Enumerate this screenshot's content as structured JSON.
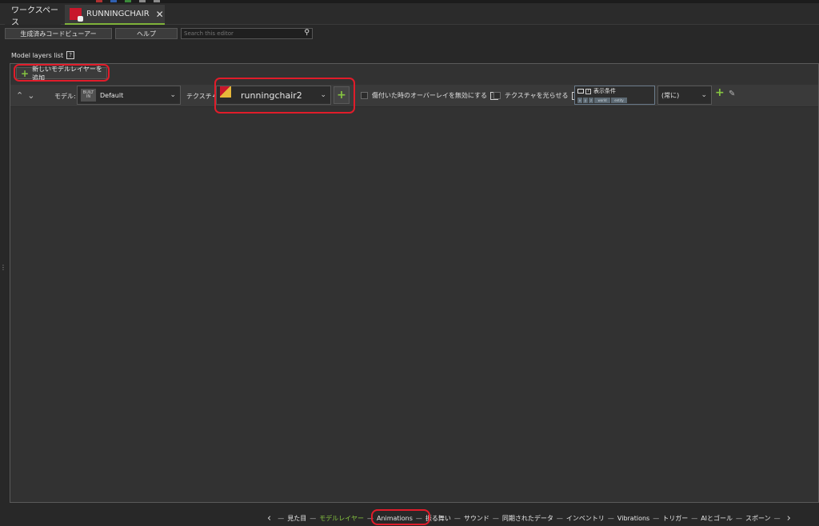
{
  "tabs": {
    "workspace_label": "ワークスペース",
    "mod_label": "RUNNINGCHAIR",
    "close_glyph": "✕"
  },
  "toolbar": {
    "code_viewer_label": "生成済みコードビューアー",
    "help_label": "ヘルプ",
    "search_placeholder": "Search this editor"
  },
  "section": {
    "title": "Model layers list",
    "help_glyph": "?"
  },
  "add_layer": {
    "label": "新しいモデルレイヤーを追加"
  },
  "layer_row": {
    "model_label": "モデル:",
    "builtin_badge": "BUILT IN",
    "model_value": "Default",
    "texture_label": "テクスチャ:",
    "texture_value": "runningchair2",
    "disable_overlay_label": "傷付いた時のオーバーレイを無効にする",
    "glow_texture_label": "テクスチャを光らせる",
    "condition_title": "表示条件",
    "condition_chips": [
      "x",
      "y",
      "z",
      "world",
      "entity"
    ],
    "condition_value": "(常に)"
  },
  "nav": {
    "items": [
      "見た目",
      "モデルレイヤー",
      "Animations",
      "振る舞い",
      "サウンド",
      "同期されたデータ",
      "インベントリ",
      "Vibrations",
      "トリガー",
      "AIとゴール",
      "スポーン"
    ],
    "active_index": 1
  },
  "colors": {
    "accent_green": "#86c540",
    "highlight_red": "#e11c2a",
    "mod_icon_red": "#c8172b"
  }
}
